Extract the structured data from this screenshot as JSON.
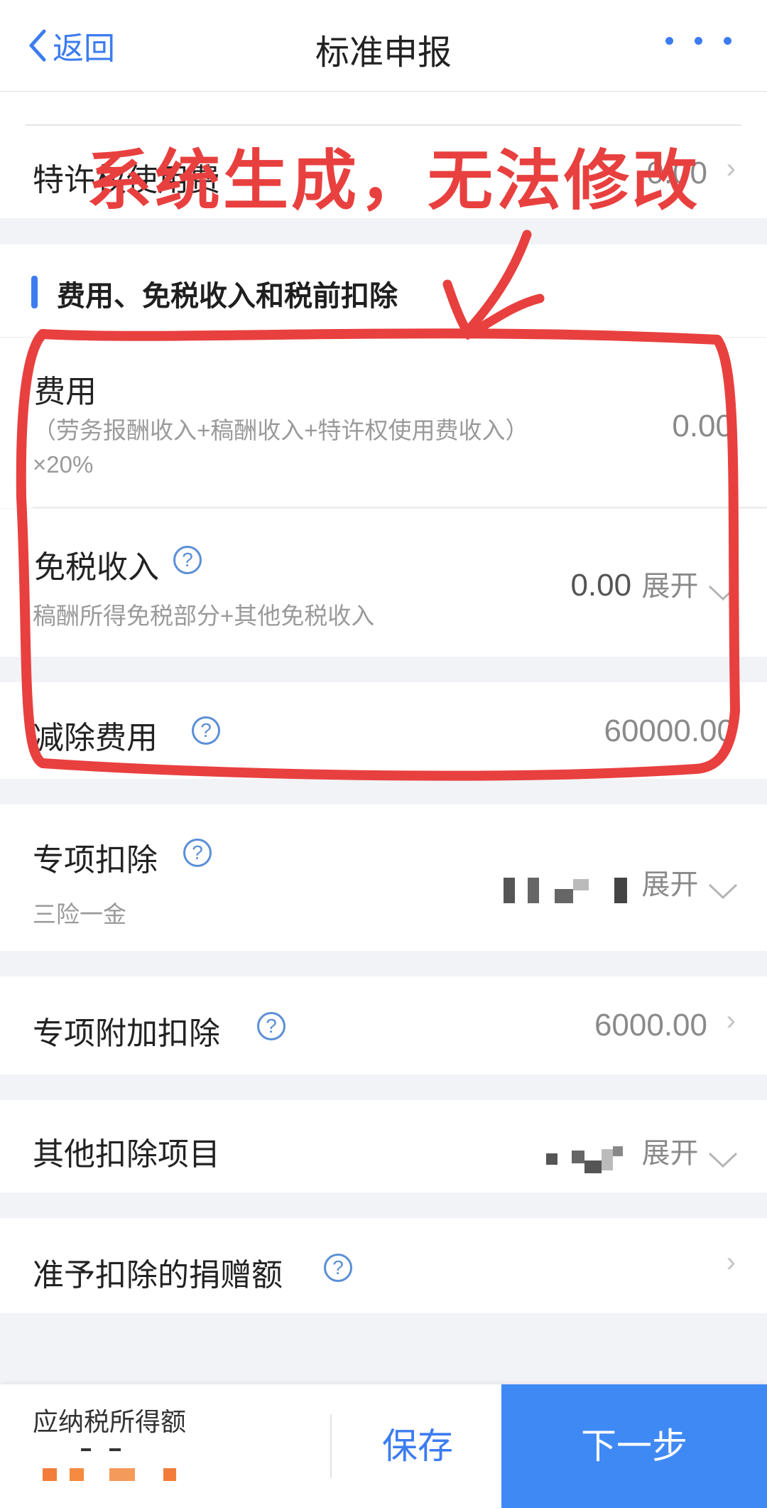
{
  "nav": {
    "back_label": "返回",
    "title": "标准申报"
  },
  "annotation": {
    "text": "系统生成，无法修改"
  },
  "rows": {
    "franchise": {
      "label": "特许权使用费",
      "value": "0.00"
    },
    "section_title": "费用、免税收入和税前扣除",
    "expenses": {
      "label": "费用",
      "formula": "（劳务报酬收入+稿酬收入+特许权使用费收入）",
      "formula2": "×20%",
      "value": "0.00"
    },
    "tax_free": {
      "label": "免税收入",
      "sub": "稿酬所得免税部分+其他免税收入",
      "value": "0.00",
      "expand": "展开"
    },
    "deduction": {
      "label": "减除费用",
      "value": "60000.00"
    },
    "special": {
      "label": "专项扣除",
      "sub": "三险一金",
      "expand": "展开"
    },
    "special_additional": {
      "label": "专项附加扣除",
      "value": "6000.00"
    },
    "other": {
      "label": "其他扣除项目",
      "expand": "展开"
    },
    "donation": {
      "label": "准予扣除的捐赠额"
    }
  },
  "bottom": {
    "taxable_label": "应纳税所得额",
    "save": "保存",
    "next": "下一步"
  },
  "colors": {
    "accent": "#3c7cf0",
    "annotation": "#e8403f",
    "next_bg": "#3f89f5"
  }
}
